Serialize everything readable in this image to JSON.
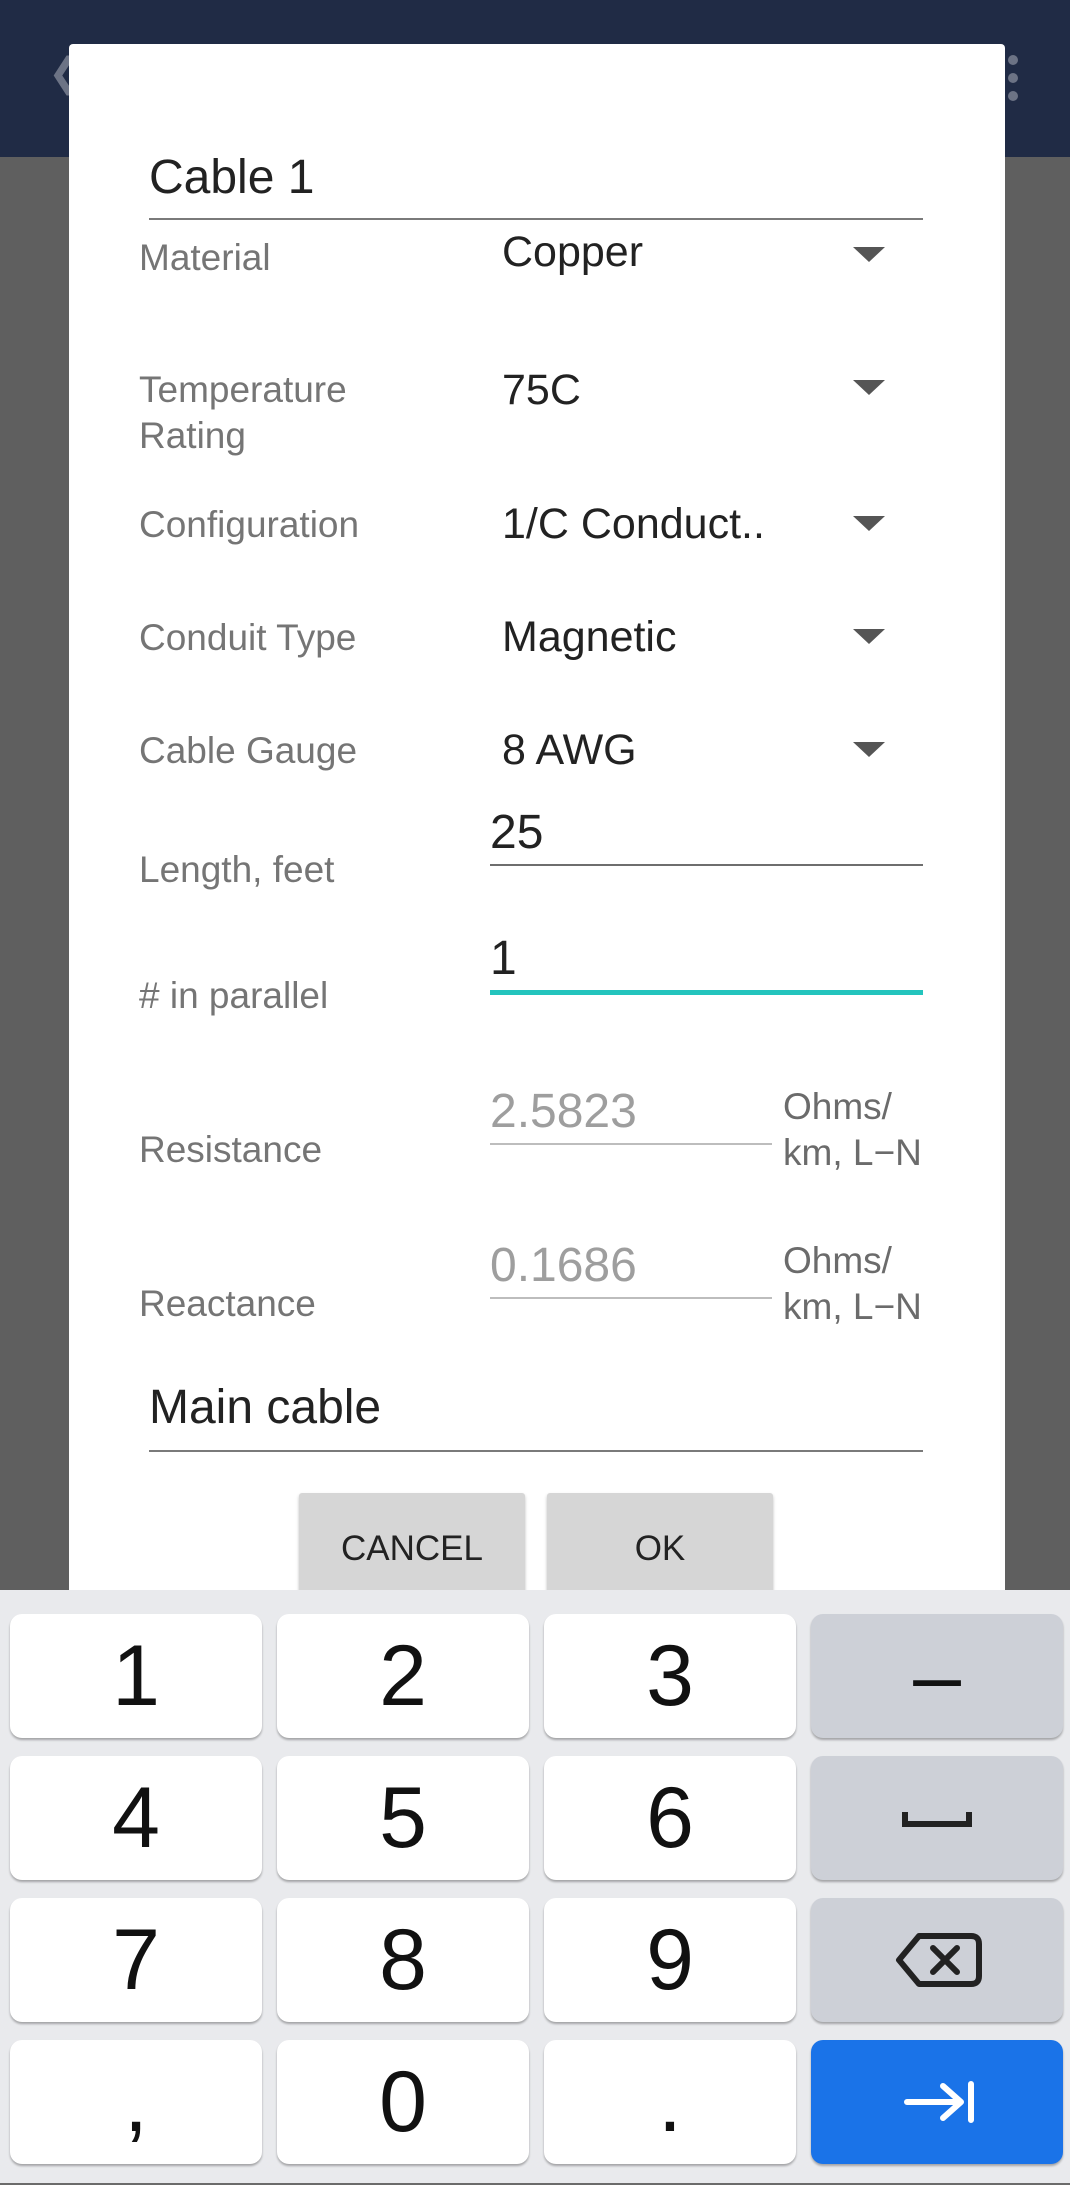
{
  "dialog": {
    "title_value": "Cable 1",
    "rows": [
      {
        "label": "Material",
        "value": "Copper"
      },
      {
        "label": "Temperature\nRating",
        "value": "75C"
      },
      {
        "label": "Configuration",
        "value": "1/C Conduct.."
      },
      {
        "label": "Conduit Type",
        "value": "Magnetic"
      },
      {
        "label": "Cable Gauge",
        "value": "8 AWG"
      }
    ],
    "length": {
      "label": "Length, feet",
      "value": "25"
    },
    "parallel": {
      "label": "# in parallel",
      "value": "1"
    },
    "resistance": {
      "label": "Resistance",
      "value": "2.5823",
      "unit": "Ohms/\nkm, L−N"
    },
    "reactance": {
      "label": "Reactance",
      "value": "0.1686",
      "unit": "Ohms/\nkm, L−N"
    },
    "note_value": "Main cable",
    "cancel_label": "CANCEL",
    "ok_label": "OK"
  },
  "keyboard": {
    "keys": [
      "1",
      "2",
      "3",
      "–",
      "4",
      "5",
      "6",
      "",
      "7",
      "8",
      "9",
      "",
      ",",
      "0",
      ".",
      ""
    ],
    "icons": {
      "space": "space-icon",
      "backspace": "backspace-icon",
      "next": "tab-next-icon"
    },
    "accent": "#1a73e8"
  },
  "colors": {
    "appbar": "#202b45",
    "active_underline": "#23c4bd"
  }
}
